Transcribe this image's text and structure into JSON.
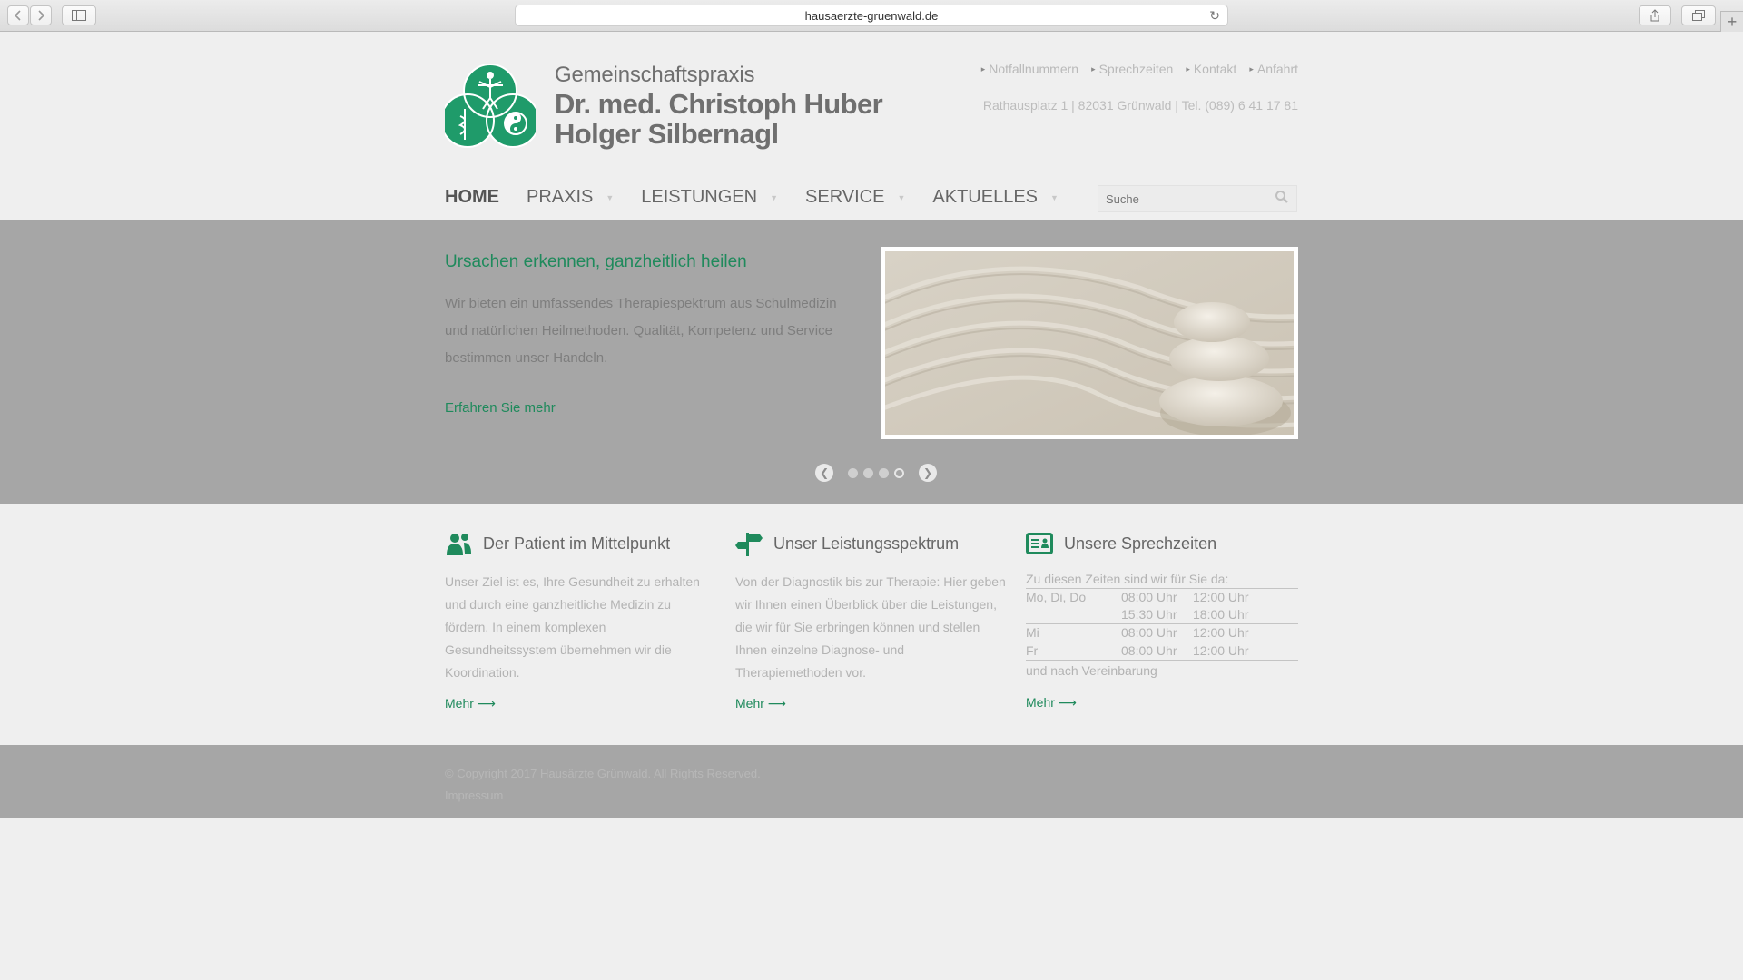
{
  "browser": {
    "url": "hausaerzte-gruenwald.de"
  },
  "header": {
    "brand_line1": "Gemeinschaftspraxis",
    "brand_line2": "Dr. med. Christoph Huber",
    "brand_line3": "Holger Silbernagl",
    "top_links": [
      "Notfallnummern",
      "Sprechzeiten",
      "Kontakt",
      "Anfahrt"
    ],
    "address": "Rathausplatz 1 | 82031 Grünwald | Tel. (089) 6 41 17 81"
  },
  "nav": {
    "items": [
      "HOME",
      "PRAXIS",
      "LEISTUNGEN",
      "SERVICE",
      "AKTUELLES"
    ],
    "search_placeholder": "Suche"
  },
  "slider": {
    "title": "Ursachen erkennen, ganzheitlich heilen",
    "text": "Wir bieten ein umfassendes Therapiespektrum aus Schulmedizin und natürlichen Heilmethoden. Qualität, Kompetenz und Service bestimmen unser Handeln.",
    "link": "Erfahren Sie mehr",
    "slides_total": 4,
    "active_slide": 4
  },
  "columns": {
    "patient": {
      "title": "Der Patient im Mittelpunkt",
      "text": "Unser Ziel ist es, Ihre Gesundheit zu erhalten und durch eine ganzheitliche Medizin zu fördern. In einem komplexen Gesundheitssystem übernehmen wir die Koordination.",
      "more": "Mehr"
    },
    "services": {
      "title": "Unser Leistungsspektrum",
      "text": "Von der Diagnostik bis zur Therapie: Hier geben wir Ihnen einen Überblick über die Leistungen, die wir für Sie erbringen können und stellen Ihnen einzelne Diagnose- und Therapiemethoden vor.",
      "more": "Mehr"
    },
    "hours": {
      "title": "Unsere Sprechzeiten",
      "lead": "Zu diesen Zeiten sind wir für Sie da:",
      "rows": [
        {
          "day": "Mo, Di, Do",
          "from": "08:00 Uhr",
          "to": "12:00 Uhr"
        },
        {
          "day": "",
          "from": "15:30 Uhr",
          "to": "18:00 Uhr"
        },
        {
          "day": "Mi",
          "from": "08:00 Uhr",
          "to": "12:00 Uhr"
        },
        {
          "day": "Fr",
          "from": "08:00 Uhr",
          "to": "12:00 Uhr"
        }
      ],
      "after": "und nach Vereinbarung",
      "more": "Mehr"
    }
  },
  "footer": {
    "copyright": "© Copyright 2017 Hausärzte Grünwald. All Rights Reserved.",
    "imprint": "Impressum"
  },
  "colors": {
    "accent": "#1f8a5c",
    "slider_bg": "#a6a6a6",
    "page_bg": "#efefef"
  }
}
